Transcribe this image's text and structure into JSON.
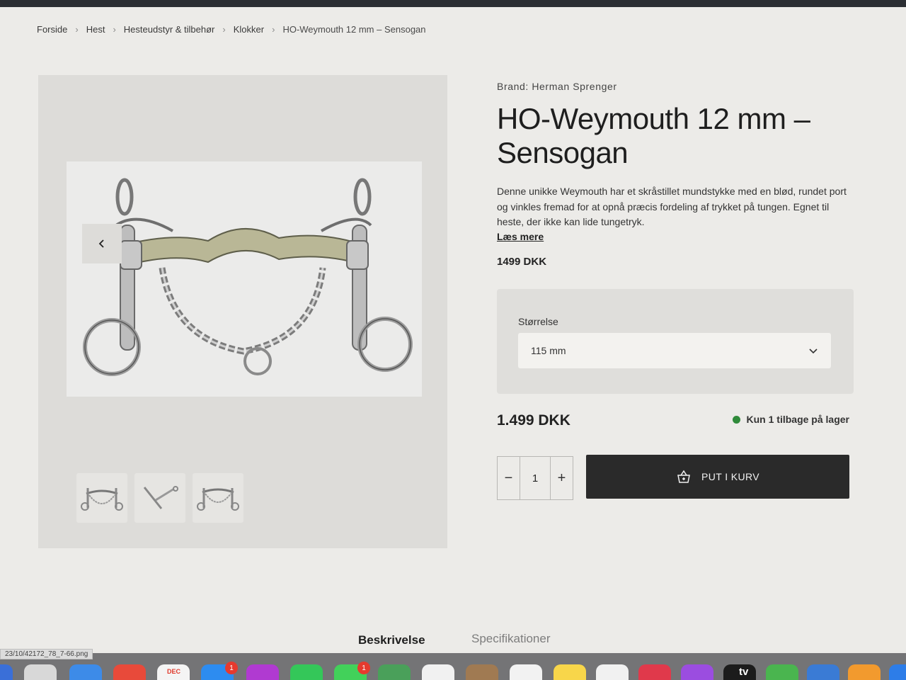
{
  "breadcrumb": {
    "items": [
      "Forside",
      "Hest",
      "Hesteudstyr & tilbehør",
      "Klokker"
    ],
    "current": "HO-Weymouth 12 mm – Sensogan"
  },
  "product": {
    "brand": "Brand: Herman Sprenger",
    "title": "HO-Weymouth 12 mm – Sensogan",
    "description": "Denne unikke Weymouth har et skråstillet mundstykke med en blød, rundet port og vinkles fremad for at opnå præcis fordeling af trykket på tungen. Egnet til heste, der ikke kan lide tungetryk.",
    "read_more": "Læs mere",
    "price_short": "1499 DKK",
    "price": "1.499 DKK"
  },
  "variant": {
    "label": "Størrelse",
    "selected": "115 mm"
  },
  "stock": {
    "text": "Kun 1 tilbage på lager",
    "color": "#2f8a3a"
  },
  "quantity": {
    "minus": "−",
    "value": "1",
    "plus": "+"
  },
  "cart": {
    "label": "PUT I KURV"
  },
  "tabs": [
    "Beskrivelse",
    "Specifikationer"
  ],
  "status": {
    "file": "23/10/42172_78_7-66.png"
  },
  "dock": {
    "calendar_month": "DEC",
    "mail_badge": "1",
    "messages_badge": "1",
    "tv_label": "tv"
  }
}
